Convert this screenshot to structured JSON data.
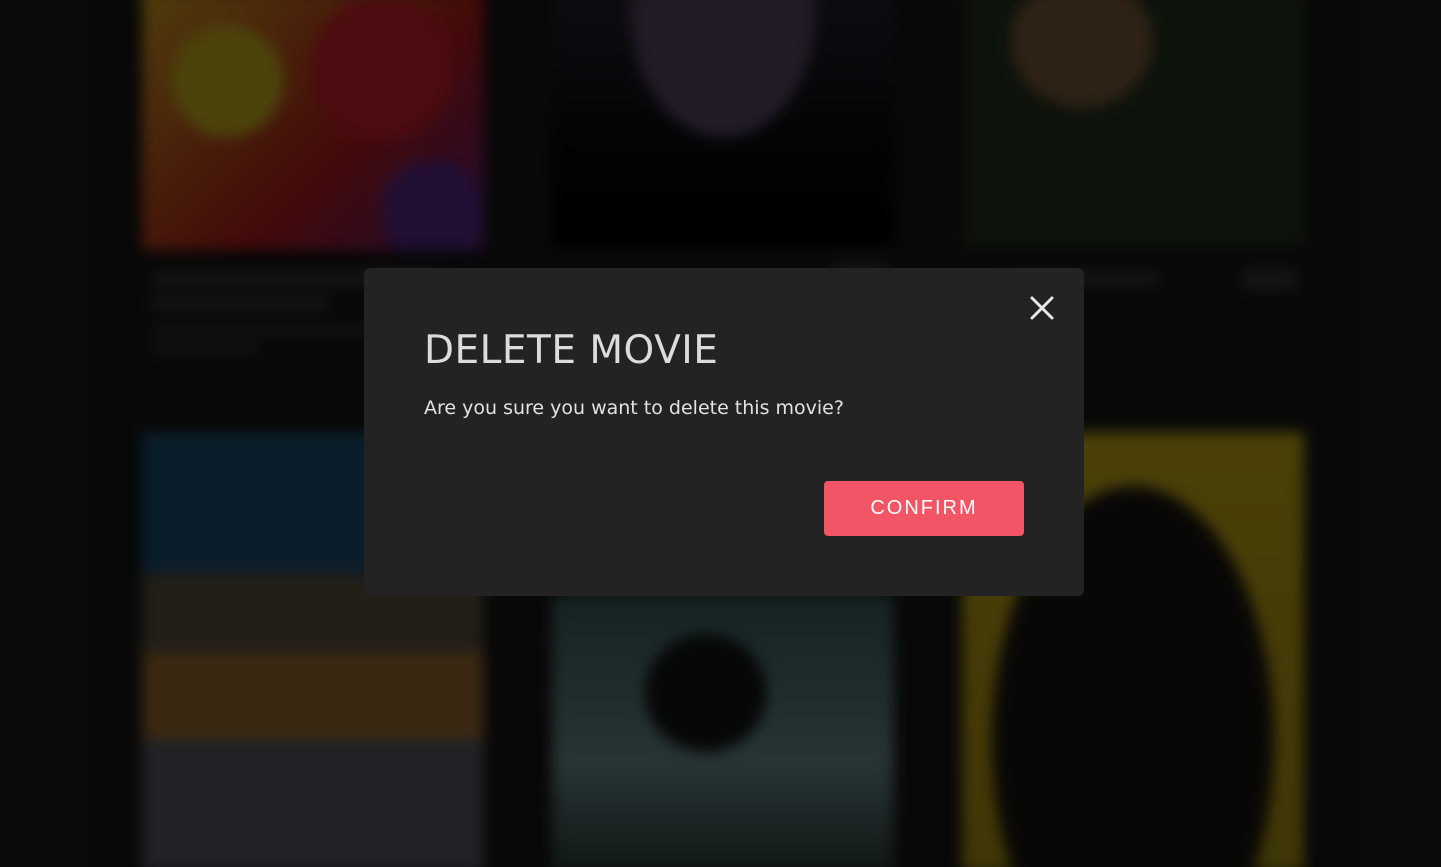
{
  "modal": {
    "title": "DELETE MOVIE",
    "message": "Are you sure you want to delete this movie?",
    "confirm_label": "CONFIRM",
    "close_icon": "close-icon",
    "accent_color": "#f25565"
  }
}
